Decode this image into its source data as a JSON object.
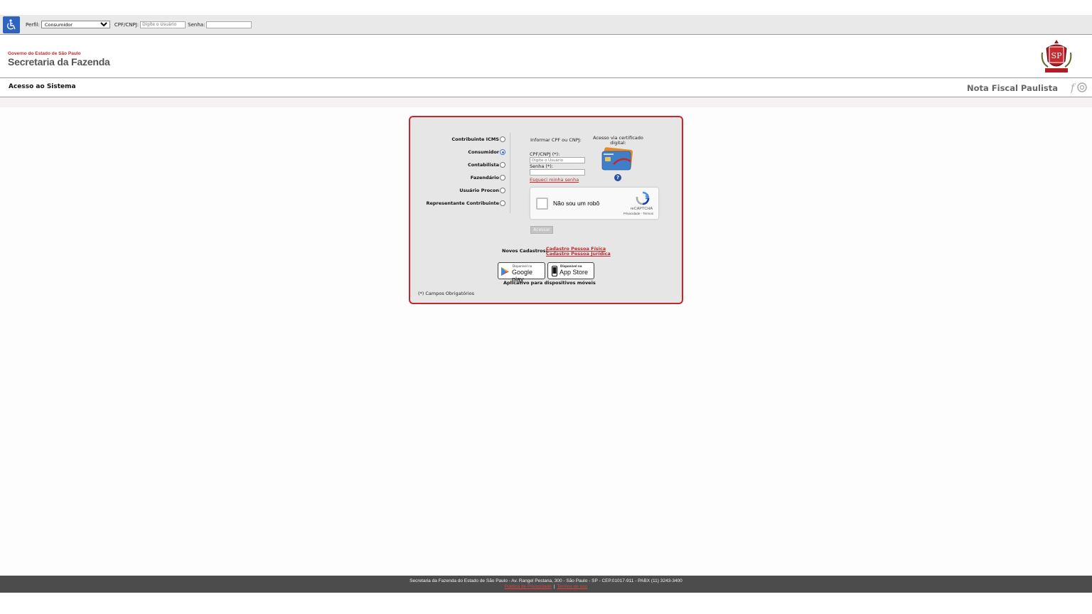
{
  "topbar": {
    "perfil_label": "Perfil:",
    "perfil_value": "Consumidor",
    "cpf_label": "CPF/CNPJ:",
    "cpf_placeholder": "Digite o Usuário",
    "senha_label": "Senha:"
  },
  "header": {
    "gov_text": "Governo do Estado de São Paulo",
    "sef_text": "Secretaria da Fazenda"
  },
  "titlebar": {
    "page_title": "Acesso ao Sistema",
    "app_title": "Nota Fiscal Paulista"
  },
  "login": {
    "profiles": [
      {
        "label": "Contribuinte ICMS",
        "checked": false
      },
      {
        "label": "Consumidor",
        "checked": true
      },
      {
        "label": "Contabilista",
        "checked": false
      },
      {
        "label": "Fazendário",
        "checked": false
      },
      {
        "label": "Usuário Procon",
        "checked": false
      },
      {
        "label": "Representante Contribuinte",
        "checked": false
      }
    ],
    "inform_label": "Informar CPF ou CNPJ:",
    "cert_label": "Acesso via certificado digital:",
    "cpf_label": "CPF/CNPJ (*):",
    "cpf_placeholder": "Digite o Usuário",
    "senha_label": "Senha (*):",
    "forgot_link": "Esqueci minha senha",
    "captcha": {
      "label": "Não sou um robô",
      "brand": "reCAPTCHA",
      "links": "Privacidade - Termos"
    },
    "submit_label": "Acessar",
    "novos_label": "Novos Cadastros:",
    "cadastro_pf": "Cadastro Pessoa Física",
    "cadastro_pj": "Cadastro Pessoa Jurídica",
    "google_small": "Disponível na",
    "google_big": "Google play",
    "apple_small": "Disponível na",
    "apple_big": "App Store",
    "app_caption": "Aplicativo para dispositivos móveis",
    "required_note": "(*) Campos Obrigatórios"
  },
  "footer": {
    "address": "Secretaria da Fazenda do Estado de São Paulo - Av. Rangel Pestana, 300 - São Paulo - SP - CEP.01017-911 - PABX (11) 3243-3400",
    "privacy_link": "Política de Privacidade",
    "terms_link": "Termos de uso"
  },
  "colors": {
    "accent_red": "#c8262d",
    "accessibility_blue": "#2f63c0",
    "footer_bg": "#4c4c4c"
  }
}
